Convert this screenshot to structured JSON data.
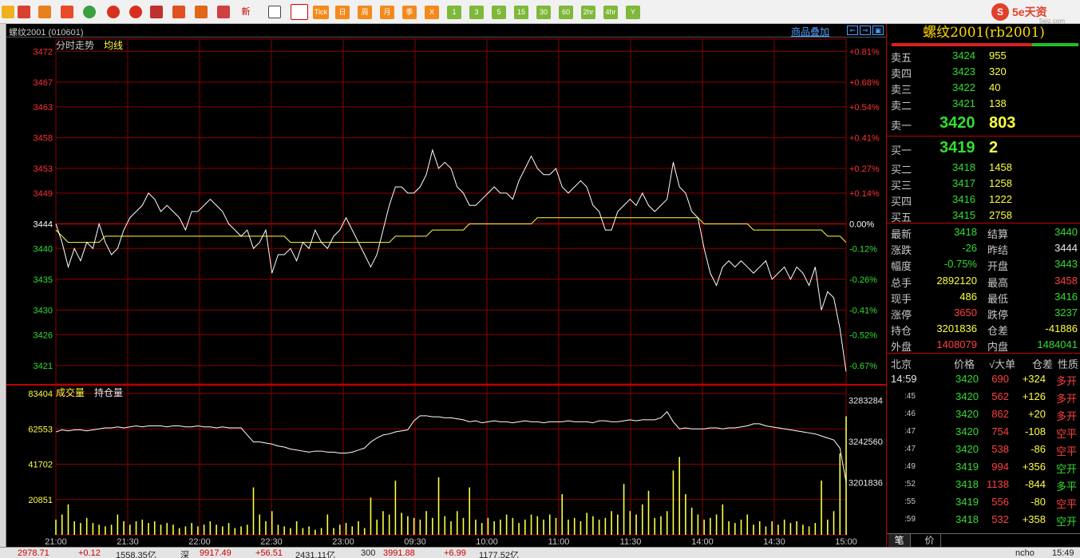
{
  "toolbar": {
    "timeframes": [
      "Tick",
      "日",
      "周",
      "月",
      "季",
      "X",
      "1",
      "3",
      "5",
      "15",
      "30",
      "60",
      "2hr",
      "4hr",
      "Y"
    ],
    "new_label": "新"
  },
  "brand": {
    "logo": "S",
    "text": "5e天资",
    "sub": "5eiz.com"
  },
  "chart": {
    "instrument_label": "螺纹2001 (010601)",
    "overlay_link": "商品叠加",
    "nav_icons": [
      "⇐",
      "⇒",
      "▣"
    ],
    "price_legend": [
      "分时走势",
      "均线"
    ],
    "volume_legend": [
      "成交量",
      "持仓量"
    ],
    "colors": {
      "grid": "#8b0000",
      "price_line": "#ffffff",
      "avg_line": "#ffff40",
      "volume_bar": "#ffff40",
      "oi_line": "#ffffff",
      "up_axis": "#ff3030",
      "down_axis": "#33dd33",
      "base": "#ffffff"
    }
  },
  "chart_data": {
    "type": "line",
    "title": "螺纹2001 (010601)",
    "time_labels": [
      "21:00",
      "21:30",
      "22:00",
      "22:30",
      "23:00",
      "09:30",
      "10:00",
      "11:00",
      "11:30",
      "14:00",
      "14:30",
      "15:00"
    ],
    "price_axis_left": [
      "3472",
      "3467",
      "3463",
      "3458",
      "3453",
      "3449",
      "3444",
      "3440",
      "3435",
      "3430",
      "3426",
      "3421"
    ],
    "price_axis_right": [
      "+0.81%",
      "+0.68%",
      "+0.54%",
      "+0.41%",
      "+0.27%",
      "+0.14%",
      "0.00%",
      "-0.12%",
      "-0.26%",
      "-0.41%",
      "-0.52%",
      "-0.67%"
    ],
    "price_range": [
      3418,
      3474
    ],
    "previous_settle": 3444,
    "price_series": {
      "name": "分时走势",
      "values": [
        3444,
        3441,
        3437,
        3440,
        3438,
        3441,
        3440,
        3444,
        3441,
        3439,
        3440,
        3443,
        3445,
        3446,
        3447,
        3449,
        3448,
        3446,
        3447,
        3446,
        3445,
        3443,
        3446,
        3446,
        3447,
        3448,
        3447,
        3446,
        3444,
        3443,
        3442,
        3443,
        3440,
        3441,
        3443,
        3436,
        3439,
        3439,
        3440,
        3438,
        3441,
        3440,
        3443,
        3441,
        3440,
        3442,
        3443,
        3445,
        3443,
        3441,
        3439,
        3437,
        3439,
        3443,
        3447,
        3450,
        3450,
        3449,
        3449,
        3450,
        3452,
        3456,
        3453,
        3454,
        3453,
        3450,
        3449,
        3447,
        3447,
        3448,
        3449,
        3450,
        3449,
        3449,
        3448,
        3451,
        3453,
        3455,
        3453,
        3452,
        3452,
        3453,
        3450,
        3449,
        3450,
        3451,
        3450,
        3447,
        3446,
        3443,
        3443,
        3446,
        3447,
        3448,
        3447,
        3449,
        3447,
        3446,
        3447,
        3448,
        3454,
        3450,
        3449,
        3446,
        3445,
        3440,
        3436,
        3434,
        3437,
        3438,
        3437,
        3438,
        3437,
        3436,
        3437,
        3438,
        3435,
        3436,
        3437,
        3435,
        3437,
        3436,
        3434,
        3437,
        3430,
        3433,
        3432,
        3427,
        3420
      ]
    },
    "avg_series": {
      "name": "均线",
      "values": [
        3443,
        3442,
        3441,
        3441,
        3441,
        3441,
        3441,
        3441,
        3442,
        3442,
        3442,
        3442,
        3442,
        3442,
        3442,
        3442,
        3442,
        3442,
        3442,
        3442,
        3442,
        3442,
        3442,
        3442,
        3442,
        3442,
        3442,
        3442,
        3442,
        3442,
        3442,
        3442,
        3442,
        3442,
        3442,
        3442,
        3442,
        3442,
        3441,
        3441,
        3441,
        3441,
        3441,
        3441,
        3441,
        3441,
        3441,
        3441,
        3441,
        3441,
        3441,
        3441,
        3441,
        3441,
        3441,
        3442,
        3442,
        3442,
        3442,
        3442,
        3442,
        3443,
        3443,
        3443,
        3443,
        3443,
        3443,
        3444,
        3444,
        3444,
        3444,
        3444,
        3444,
        3444,
        3444,
        3444,
        3444,
        3444,
        3445,
        3445,
        3445,
        3445,
        3445,
        3445,
        3445,
        3445,
        3445,
        3445,
        3445,
        3445,
        3445,
        3445,
        3445,
        3445,
        3445,
        3445,
        3445,
        3445,
        3445,
        3445,
        3445,
        3445,
        3445,
        3445,
        3445,
        3444,
        3444,
        3444,
        3444,
        3444,
        3444,
        3444,
        3444,
        3443,
        3443,
        3443,
        3443,
        3443,
        3443,
        3443,
        3443,
        3443,
        3443,
        3443,
        3443,
        3442,
        3442,
        3442,
        3441
      ]
    },
    "volume_axis_left": [
      "83404",
      "62553",
      "41702",
      "20851"
    ],
    "oi_axis_right": [
      "3283284",
      "3242560",
      "3201836"
    ],
    "volume_range": [
      0,
      83404
    ],
    "oi_range": [
      3150000,
      3290000
    ],
    "volume_series": {
      "name": "成交量",
      "values": [
        9000,
        12000,
        18000,
        8000,
        7000,
        10000,
        7000,
        6000,
        5000,
        6000,
        12000,
        8000,
        6000,
        8000,
        9000,
        7000,
        8000,
        6000,
        7000,
        6000,
        4000,
        5000,
        7000,
        5000,
        6000,
        8000,
        6000,
        5000,
        7000,
        4000,
        5000,
        6000,
        28000,
        12000,
        8000,
        14000,
        6000,
        5000,
        4000,
        8000,
        4000,
        5000,
        3000,
        4000,
        12000,
        4000,
        6000,
        7000,
        5000,
        8000,
        4000,
        22000,
        9000,
        14000,
        12000,
        32000,
        13000,
        11000,
        10000,
        9000,
        14000,
        10000,
        34000,
        11000,
        8000,
        14000,
        10000,
        28000,
        9000,
        7000,
        10000,
        8000,
        9000,
        12000,
        10000,
        7000,
        9000,
        12000,
        11000,
        9000,
        12000,
        10000,
        24000,
        9000,
        10000,
        8000,
        13000,
        11000,
        9000,
        10000,
        14000,
        12000,
        30000,
        14000,
        12000,
        18000,
        26000,
        10000,
        11000,
        14000,
        38000,
        46000,
        24000,
        16000,
        12000,
        9000,
        10000,
        12000,
        18000,
        8000,
        7000,
        9000,
        12000,
        6000,
        8000,
        5000,
        8000,
        6000,
        9000,
        7000,
        8000,
        6000,
        5000,
        7000,
        32000,
        9000,
        14000,
        48000,
        70000
      ]
    },
    "oi_series": {
      "name": "持仓量",
      "values": [
        3252000,
        3254000,
        3253000,
        3254000,
        3254000,
        3253000,
        3254000,
        3255000,
        3256000,
        3256000,
        3257000,
        3256000,
        3257000,
        3258000,
        3257000,
        3258000,
        3258000,
        3258000,
        3257000,
        3258000,
        3258000,
        3257000,
        3257000,
        3258000,
        3257000,
        3257000,
        3256000,
        3257000,
        3256000,
        3256000,
        3256000,
        3249000,
        3242000,
        3242000,
        3241000,
        3240000,
        3238000,
        3237000,
        3235000,
        3234000,
        3233000,
        3232000,
        3233000,
        3233000,
        3232000,
        3232000,
        3231000,
        3231000,
        3232000,
        3234000,
        3236000,
        3242000,
        3246000,
        3249000,
        3250000,
        3252000,
        3253000,
        3254000,
        3263000,
        3268000,
        3268000,
        3267000,
        3267000,
        3266000,
        3266000,
        3265000,
        3264000,
        3262000,
        3263000,
        3261000,
        3262000,
        3263000,
        3262000,
        3262000,
        3261000,
        3262000,
        3263000,
        3262000,
        3262000,
        3261000,
        3262000,
        3262000,
        3262000,
        3263000,
        3262000,
        3262000,
        3262000,
        3261000,
        3263000,
        3263000,
        3262000,
        3262000,
        3263000,
        3264000,
        3263000,
        3264000,
        3264000,
        3264000,
        3266000,
        3272000,
        3262000,
        3255000,
        3256000,
        3255000,
        3255000,
        3255000,
        3256000,
        3256000,
        3255000,
        3256000,
        3256000,
        3257000,
        3258000,
        3260000,
        3260000,
        3258000,
        3257000,
        3256000,
        3255000,
        3254000,
        3253000,
        3252000,
        3251000,
        3250000,
        3248000,
        3246000,
        3244000,
        3236000,
        3202000
      ]
    },
    "grid": true
  },
  "quote": {
    "title": "螺纹2001(rb2001)",
    "asks": [
      {
        "label": "卖五",
        "price": "3424",
        "vol": "955"
      },
      {
        "label": "卖四",
        "price": "3423",
        "vol": "320"
      },
      {
        "label": "卖三",
        "price": "3422",
        "vol": "40"
      },
      {
        "label": "卖二",
        "price": "3421",
        "vol": "138"
      },
      {
        "label": "卖一",
        "price": "3420",
        "vol": "803"
      }
    ],
    "bids": [
      {
        "label": "买一",
        "price": "3419",
        "vol": "2"
      },
      {
        "label": "买二",
        "price": "3418",
        "vol": "1458"
      },
      {
        "label": "买三",
        "price": "3417",
        "vol": "1258"
      },
      {
        "label": "买四",
        "price": "3416",
        "vol": "1222"
      },
      {
        "label": "买五",
        "price": "3415",
        "vol": "2758"
      }
    ],
    "stats": [
      {
        "l1": "最新",
        "v1": "3418",
        "c1": "green",
        "l2": "结算",
        "v2": "3440",
        "c2": "green"
      },
      {
        "l1": "涨跌",
        "v1": "-26",
        "c1": "green",
        "l2": "昨结",
        "v2": "3444",
        "c2": "white"
      },
      {
        "l1": "幅度",
        "v1": "-0.75%",
        "c1": "green",
        "l2": "开盘",
        "v2": "3443",
        "c2": "green"
      },
      {
        "l1": "总手",
        "v1": "2892120",
        "c1": "yellow",
        "l2": "最高",
        "v2": "3458",
        "c2": "red"
      },
      {
        "l1": "现手",
        "v1": "486",
        "c1": "yellow",
        "l2": "最低",
        "v2": "3416",
        "c2": "green"
      },
      {
        "l1": "涨停",
        "v1": "3650",
        "c1": "red",
        "l2": "跌停",
        "v2": "3237",
        "c2": "green"
      },
      {
        "l1": "持仓",
        "v1": "3201836",
        "c1": "yellow",
        "l2": "仓差",
        "v2": "-41886",
        "c2": "yellow"
      },
      {
        "l1": "外盘",
        "v1": "1408079",
        "c1": "red",
        "l2": "内盘",
        "v2": "1484041",
        "c2": "green"
      }
    ],
    "ticks_header": {
      "city": "北京",
      "price": "价格",
      "vol": "√大单",
      "oi": "仓差",
      "nature": "性质"
    },
    "ticks": [
      {
        "time": "14:59",
        "price": "3420",
        "vol": "690",
        "oi": "+324",
        "nature": "多开",
        "nc": "red"
      },
      {
        "time": ":45",
        "price": "3420",
        "vol": "562",
        "oi": "+126",
        "nature": "多开",
        "nc": "red"
      },
      {
        "time": ":46",
        "price": "3420",
        "vol": "862",
        "oi": "+20",
        "nature": "多开",
        "nc": "red"
      },
      {
        "time": ":47",
        "price": "3420",
        "vol": "754",
        "oi": "-108",
        "nature": "空平",
        "nc": "red"
      },
      {
        "time": ":47",
        "price": "3420",
        "vol": "538",
        "oi": "-86",
        "nature": "空平",
        "nc": "red"
      },
      {
        "time": ":49",
        "price": "3419",
        "vol": "994",
        "oi": "+356",
        "nature": "空开",
        "nc": "green"
      },
      {
        "time": ":52",
        "price": "3418",
        "vol": "1138",
        "oi": "-844",
        "nature": "多平",
        "nc": "green"
      },
      {
        "time": ":55",
        "price": "3419",
        "vol": "556",
        "oi": "-80",
        "nature": "空平",
        "nc": "red"
      },
      {
        "time": ":59",
        "price": "3418",
        "vol": "532",
        "oi": "+358",
        "nature": "空开",
        "nc": "green"
      }
    ],
    "tabs": [
      "笔",
      "价"
    ]
  },
  "statusbar": {
    "items": [
      "2978.71",
      "+0.12",
      "1558.35亿",
      "深",
      "9917.49",
      "+56.51",
      "2431.11亿",
      "300",
      "3991.88",
      "+6.99",
      "1177.52亿"
    ],
    "right": "ncho",
    "clock": "15:49"
  }
}
